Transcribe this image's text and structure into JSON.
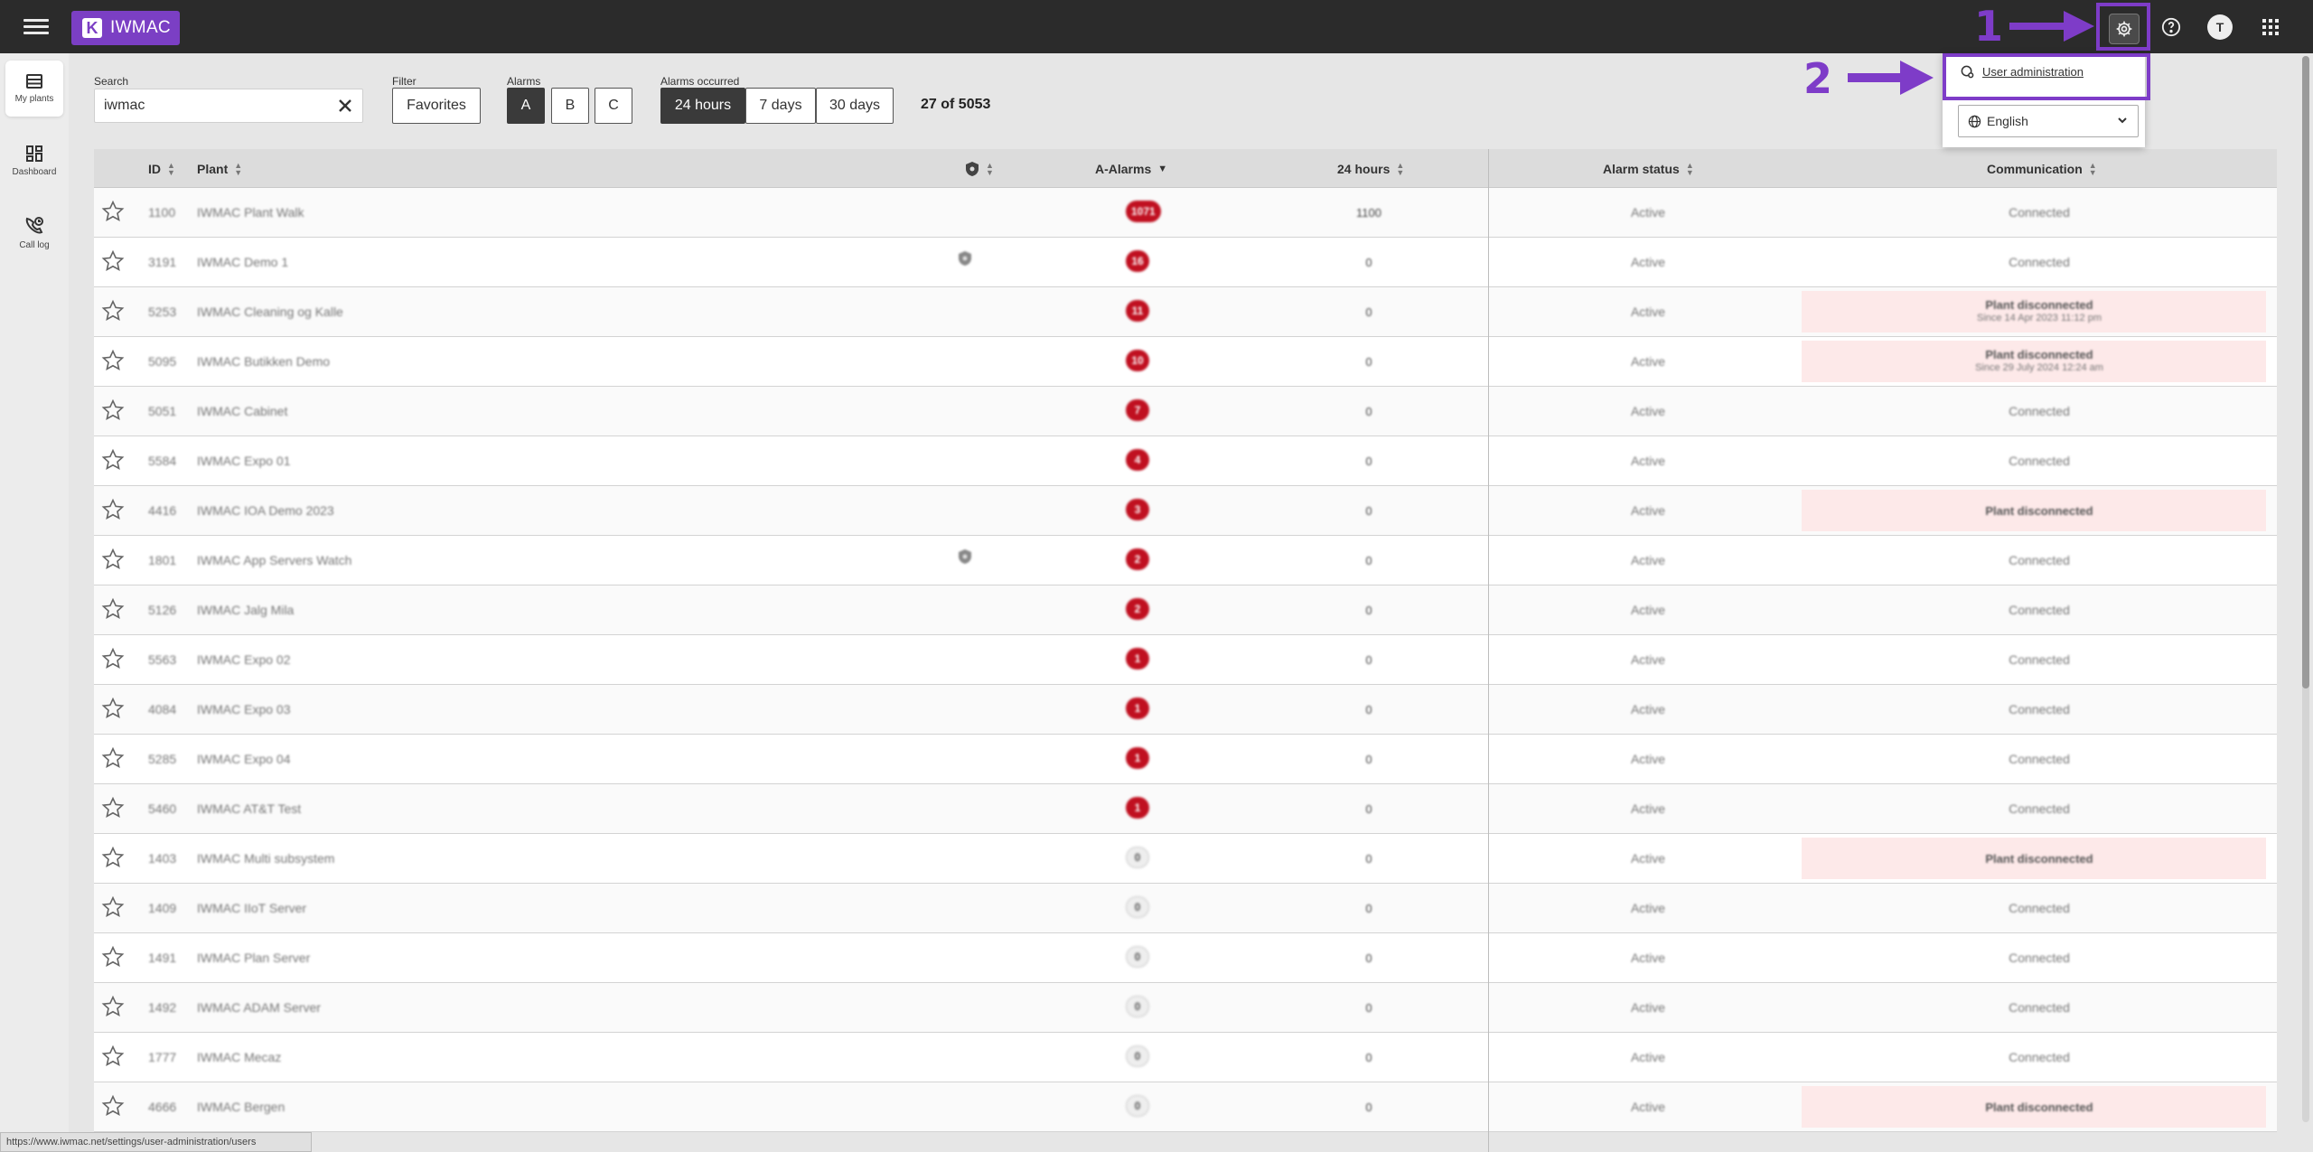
{
  "app": {
    "logo_text": "IWMAC"
  },
  "topbar": {
    "avatar_initial": "T"
  },
  "annotations": {
    "step1": "1",
    "step2": "2",
    "color": "#7e3cc8"
  },
  "sidebar": {
    "items": [
      {
        "label": "My plants"
      },
      {
        "label": "Dashboard"
      },
      {
        "label": "Call log"
      }
    ]
  },
  "toolbar": {
    "search_label": "Search",
    "search_value": "iwmac",
    "filter_label": "Filter",
    "favorites_label": "Favorites",
    "alarms_label": "Alarms",
    "alarm_a": "A",
    "alarm_b": "B",
    "alarm_c": "C",
    "occurred_label": "Alarms occurred",
    "range_24h": "24 hours",
    "range_7d": "7 days",
    "range_30d": "30 days",
    "count": "27 of 5053"
  },
  "dropdown": {
    "user_admin": "User administration",
    "language": "English"
  },
  "table": {
    "headers": {
      "id": "ID",
      "plant": "Plant",
      "a_alarms": "A-Alarms",
      "hours": "24 hours",
      "alarm_status": "Alarm status",
      "communication": "Communication"
    },
    "rows": [
      {
        "id": "1100",
        "plant": "IWMAC Plant Walk",
        "shield": false,
        "a": "1071",
        "a_red": true,
        "h": "1100",
        "status": "Active",
        "comm": "Connected",
        "disc": false,
        "sub": ""
      },
      {
        "id": "3191",
        "plant": "IWMAC Demo 1",
        "shield": true,
        "a": "16",
        "a_red": true,
        "h": "0",
        "status": "Active",
        "comm": "Connected",
        "disc": false,
        "sub": ""
      },
      {
        "id": "5253",
        "plant": "IWMAC Cleaning og Kalle",
        "shield": false,
        "a": "11",
        "a_red": true,
        "h": "0",
        "status": "Active",
        "comm": "Plant disconnected",
        "disc": true,
        "sub": "Since 14 Apr 2023 11:12 pm"
      },
      {
        "id": "5095",
        "plant": "IWMAC Butikken Demo",
        "shield": false,
        "a": "10",
        "a_red": true,
        "h": "0",
        "status": "Active",
        "comm": "Plant disconnected",
        "disc": true,
        "sub": "Since 29 July 2024 12:24 am"
      },
      {
        "id": "5051",
        "plant": "IWMAC Cabinet",
        "shield": false,
        "a": "7",
        "a_red": true,
        "h": "0",
        "status": "Active",
        "comm": "Connected",
        "disc": false,
        "sub": ""
      },
      {
        "id": "5584",
        "plant": "IWMAC Expo 01",
        "shield": false,
        "a": "4",
        "a_red": true,
        "h": "0",
        "status": "Active",
        "comm": "Connected",
        "disc": false,
        "sub": ""
      },
      {
        "id": "4416",
        "plant": "IWMAC IOA Demo 2023",
        "shield": false,
        "a": "3",
        "a_red": true,
        "h": "0",
        "status": "Active",
        "comm": "Plant disconnected",
        "disc": true,
        "sub": ""
      },
      {
        "id": "1801",
        "plant": "IWMAC App Servers Watch",
        "shield": true,
        "a": "2",
        "a_red": true,
        "h": "0",
        "status": "Active",
        "comm": "Connected",
        "disc": false,
        "sub": ""
      },
      {
        "id": "5126",
        "plant": "IWMAC Jalg Mila",
        "shield": false,
        "a": "2",
        "a_red": true,
        "h": "0",
        "status": "Active",
        "comm": "Connected",
        "disc": false,
        "sub": ""
      },
      {
        "id": "5563",
        "plant": "IWMAC Expo 02",
        "shield": false,
        "a": "1",
        "a_red": true,
        "h": "0",
        "status": "Active",
        "comm": "Connected",
        "disc": false,
        "sub": ""
      },
      {
        "id": "4084",
        "plant": "IWMAC Expo 03",
        "shield": false,
        "a": "1",
        "a_red": true,
        "h": "0",
        "status": "Active",
        "comm": "Connected",
        "disc": false,
        "sub": ""
      },
      {
        "id": "5285",
        "plant": "IWMAC Expo 04",
        "shield": false,
        "a": "1",
        "a_red": true,
        "h": "0",
        "status": "Active",
        "comm": "Connected",
        "disc": false,
        "sub": ""
      },
      {
        "id": "5460",
        "plant": "IWMAC AT&T Test",
        "shield": false,
        "a": "1",
        "a_red": true,
        "h": "0",
        "status": "Active",
        "comm": "Connected",
        "disc": false,
        "sub": ""
      },
      {
        "id": "1403",
        "plant": "IWMAC Multi subsystem",
        "shield": false,
        "a": "0",
        "a_red": false,
        "h": "0",
        "status": "Active",
        "comm": "Plant disconnected",
        "disc": true,
        "sub": ""
      },
      {
        "id": "1409",
        "plant": "IWMAC IIoT Server",
        "shield": false,
        "a": "0",
        "a_red": false,
        "h": "0",
        "status": "Active",
        "comm": "Connected",
        "disc": false,
        "sub": ""
      },
      {
        "id": "1491",
        "plant": "IWMAC Plan Server",
        "shield": false,
        "a": "0",
        "a_red": false,
        "h": "0",
        "status": "Active",
        "comm": "Connected",
        "disc": false,
        "sub": ""
      },
      {
        "id": "1492",
        "plant": "IWMAC ADAM Server",
        "shield": false,
        "a": "0",
        "a_red": false,
        "h": "0",
        "status": "Active",
        "comm": "Connected",
        "disc": false,
        "sub": ""
      },
      {
        "id": "1777",
        "plant": "IWMAC Mecaz",
        "shield": false,
        "a": "0",
        "a_red": false,
        "h": "0",
        "status": "Active",
        "comm": "Connected",
        "disc": false,
        "sub": ""
      },
      {
        "id": "4666",
        "plant": "IWMAC Bergen",
        "shield": false,
        "a": "0",
        "a_red": false,
        "h": "0",
        "status": "Active",
        "comm": "Plant disconnected",
        "disc": true,
        "sub": ""
      }
    ]
  },
  "statusbar": {
    "url": "https://www.iwmac.net/settings/user-administration/users"
  },
  "colors": {
    "accent": "#7b3fc4",
    "alarm_red": "#c01020",
    "disconnected_bg": "#fde9e9"
  }
}
